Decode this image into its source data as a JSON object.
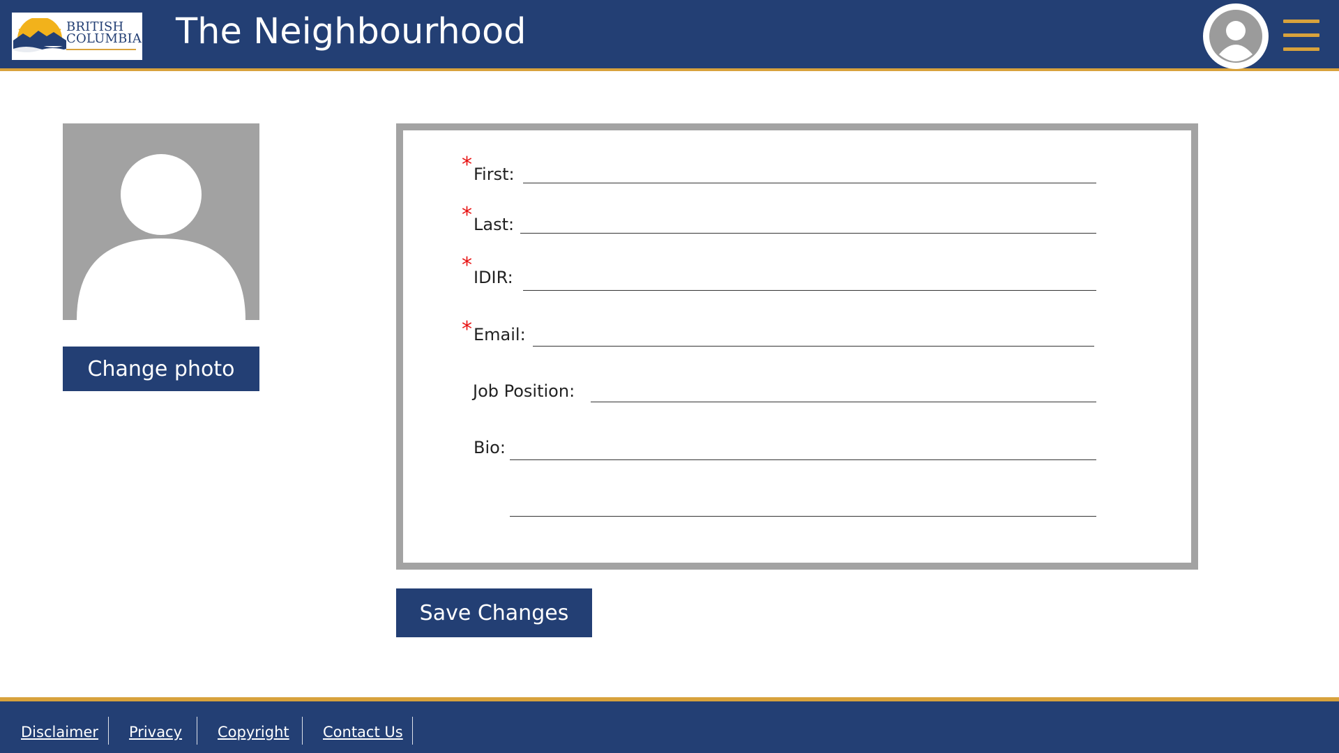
{
  "header": {
    "logo_line1": "BRITISH",
    "logo_line2": "COLUMBIA",
    "title": "The Neighbourhood",
    "colors": {
      "bar": "#233f74",
      "accent": "#d8a23c"
    }
  },
  "profile": {
    "change_photo_label": "Change photo"
  },
  "form": {
    "fields": [
      {
        "label": "First:",
        "required": true
      },
      {
        "label": "Last:",
        "required": true
      },
      {
        "label": "IDIR:",
        "required": true
      },
      {
        "label": "Email:",
        "required": true
      },
      {
        "label": "Job Position:",
        "required": false
      },
      {
        "label": "Bio:",
        "required": false
      }
    ],
    "required_marker": "*",
    "save_label": "Save Changes"
  },
  "footer": {
    "links": [
      "Disclaimer",
      "Privacy",
      "Copyright",
      "Contact Us"
    ]
  },
  "icons": [
    "bc-logo",
    "user-avatar-icon",
    "hamburger-menu-icon",
    "profile-placeholder-icon"
  ]
}
